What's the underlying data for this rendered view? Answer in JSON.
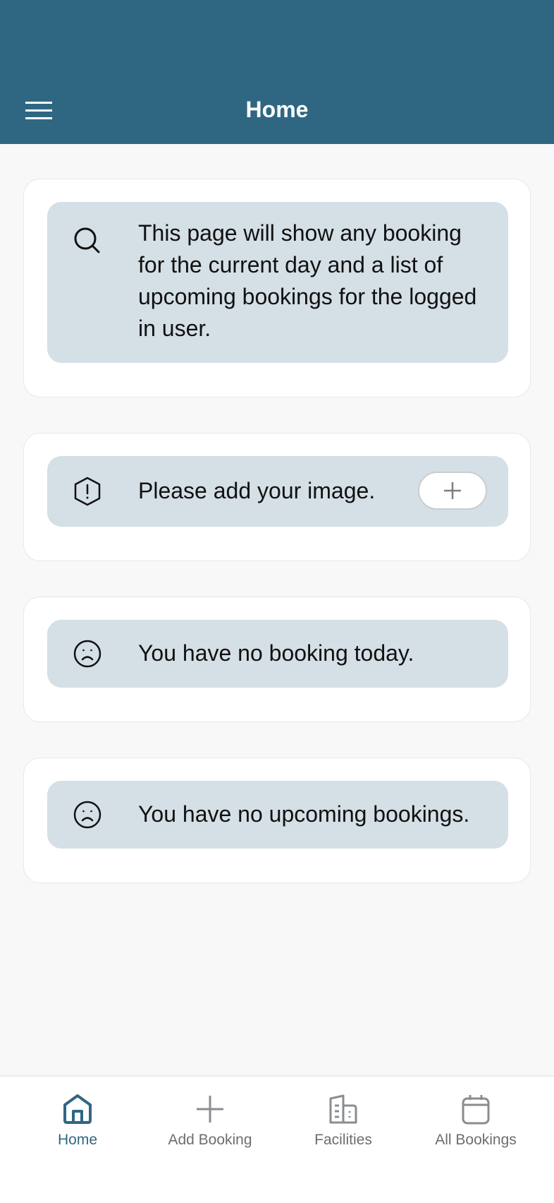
{
  "header": {
    "title": "Home",
    "menu_icon": "hamburger-menu-icon",
    "background_color": "#2f6782"
  },
  "cards": [
    {
      "icon": "search-icon",
      "text": "This page will show any booking for the current day and a list of upcoming bookings for the logged in user."
    },
    {
      "icon": "alert-hexagon-icon",
      "text": "Please add your image.",
      "button_icon": "plus-icon"
    },
    {
      "icon": "sad-face-icon",
      "text": "You have no booking today."
    },
    {
      "icon": "sad-face-icon",
      "text": "You have no upcoming bookings."
    }
  ],
  "bottom_nav": {
    "active": "Home",
    "items": [
      {
        "label": "Home",
        "icon": "home-icon"
      },
      {
        "label": "Add Booking",
        "icon": "plus-icon"
      },
      {
        "label": "Facilities",
        "icon": "building-icon"
      },
      {
        "label": "All Bookings",
        "icon": "calendar-icon"
      }
    ]
  },
  "colors": {
    "accent": "#2f6782",
    "note_background": "#d4dfe6",
    "inactive_nav": "#6b6e71"
  }
}
